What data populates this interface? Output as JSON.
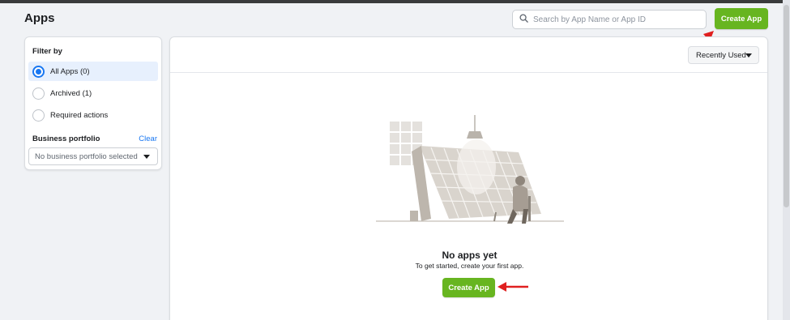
{
  "page": {
    "title": "Apps"
  },
  "search": {
    "placeholder": "Search by App Name or App ID",
    "icon": "search-icon"
  },
  "header": {
    "create_label": "Create App"
  },
  "filter": {
    "title": "Filter by",
    "options": [
      {
        "label": "All Apps (0)",
        "selected": true
      },
      {
        "label": "Archived (1)",
        "selected": false
      },
      {
        "label": "Required actions",
        "selected": false
      }
    ],
    "business_portfolio": {
      "label": "Business portfolio",
      "clear_label": "Clear",
      "select_value": "No business portfolio selected"
    }
  },
  "main": {
    "sort_label": "Recently Used",
    "empty_title": "No apps yet",
    "empty_subtitle": "To get started, create your first app.",
    "create_label": "Create App"
  },
  "colors": {
    "accent_green": "#67b520",
    "link_blue": "#1877f2",
    "annotation_red": "#e02020"
  }
}
